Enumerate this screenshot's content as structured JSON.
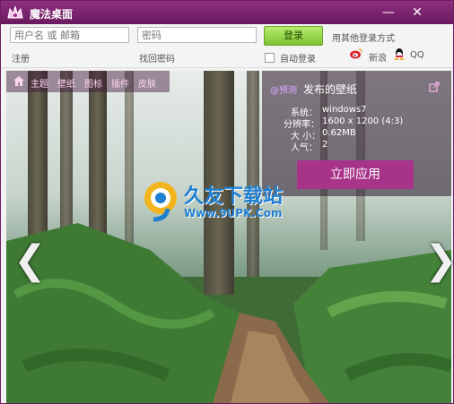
{
  "window": {
    "title": "魔法桌面",
    "minimize_glyph": "—",
    "close_glyph": "✕"
  },
  "login": {
    "username_placeholder": "用户名 或 邮箱",
    "password_placeholder": "密码",
    "login_button": "登录",
    "register": "注册",
    "forgot_password": "找回密码",
    "auto_login": "自动登录",
    "other_methods": "用其他登录方式",
    "weibo": "新浪",
    "qq": "QQ"
  },
  "nav": {
    "items": [
      "主题",
      "壁纸",
      "图标",
      "插件",
      "皮肤"
    ]
  },
  "info": {
    "user": "@预测",
    "published": "发布的壁纸",
    "system_label": "系统：",
    "system": "windows7",
    "resolution_label": "分辨率：",
    "resolution": "1600 x 1200 (4:3)",
    "size_label": "大 小：",
    "size": "0.62MB",
    "popularity_label": "人气：",
    "popularity": "2",
    "apply_button": "立即应用"
  },
  "watermark": {
    "text": "久友下载站",
    "url": "Www.9UPK.Com"
  },
  "arrows": {
    "prev": "❮",
    "next": "❯"
  }
}
